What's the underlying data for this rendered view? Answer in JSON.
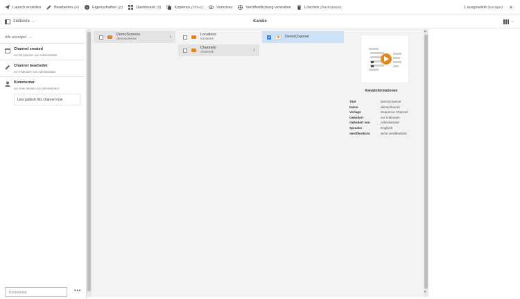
{
  "toolbar": {
    "items": [
      {
        "label": "Launch erstellen",
        "shortcut": "",
        "icon": "paper-plane-icon"
      },
      {
        "label": "Bearbeiten",
        "shortcut": "(e)",
        "icon": "pencil-icon"
      },
      {
        "label": "Eigenschaften",
        "shortcut": "(p)",
        "icon": "info-icon"
      },
      {
        "label": "Dashboard",
        "shortcut": "(d)",
        "icon": "dashboard-icon"
      },
      {
        "label": "Kopieren",
        "shortcut": "(ctrl+c)",
        "icon": "copy-icon"
      },
      {
        "label": "Vorschau",
        "shortcut": "",
        "icon": "eye-icon"
      },
      {
        "label": "Veröffentlichung verwalten",
        "shortcut": "",
        "icon": "globe-icon"
      },
      {
        "label": "Löschen",
        "shortcut": "(backspace)",
        "icon": "trash-icon"
      }
    ],
    "selected_label": "1 ausgewählt",
    "selected_shortcut": "(escape)",
    "close_icon": "close-icon"
  },
  "subbar": {
    "timeline_label": "Zeitleiste",
    "title": "Kanäle",
    "view_icon": "column-view-icon"
  },
  "timeline": {
    "filter": "Alle anzeigen",
    "entries": [
      {
        "title": "Channel created",
        "subtitle": "vor 36 Minuten von Administrator",
        "icon": "calendar-icon"
      },
      {
        "title": "Channel bearbeitet",
        "subtitle": "vor 9 Minuten von Administrator",
        "icon": "pencil-icon"
      },
      {
        "title": "Kommentar",
        "subtitle": "vor einer Minute von Administrator",
        "icon": "user-icon"
      }
    ],
    "comment_text": "Lets publish this channel now",
    "comment_placeholder": "Kommentar",
    "more_label": "•••"
  },
  "columns": {
    "col1": [
      {
        "title": "DemoScreens",
        "sub": "demoscreens"
      }
    ],
    "col2": [
      {
        "title": "Locations",
        "sub": "locations"
      },
      {
        "title": "Channels",
        "sub": "channels"
      }
    ],
    "col3": [
      {
        "title": "DemoChannel",
        "sub": ""
      }
    ]
  },
  "preview": {
    "heading": "Kanalinformationen",
    "meta": [
      {
        "k": "Titel",
        "v": "DemoChannel"
      },
      {
        "k": "Name",
        "v": "demochannel"
      },
      {
        "k": "Vorlage",
        "v": "Sequence Channel"
      },
      {
        "k": "Geändert",
        "v": "vor 9 Minuten"
      },
      {
        "k": "Geändert von",
        "v": "Administrator"
      },
      {
        "k": "Sprache",
        "v": "Englisch"
      },
      {
        "k": "Veröffentlicht",
        "v": "Nicht veröffentlicht"
      }
    ]
  },
  "colors": {
    "accent": "#2680eb",
    "folder": "#e68619",
    "selected_row": "#cde2f7",
    "play": "#e68619"
  }
}
